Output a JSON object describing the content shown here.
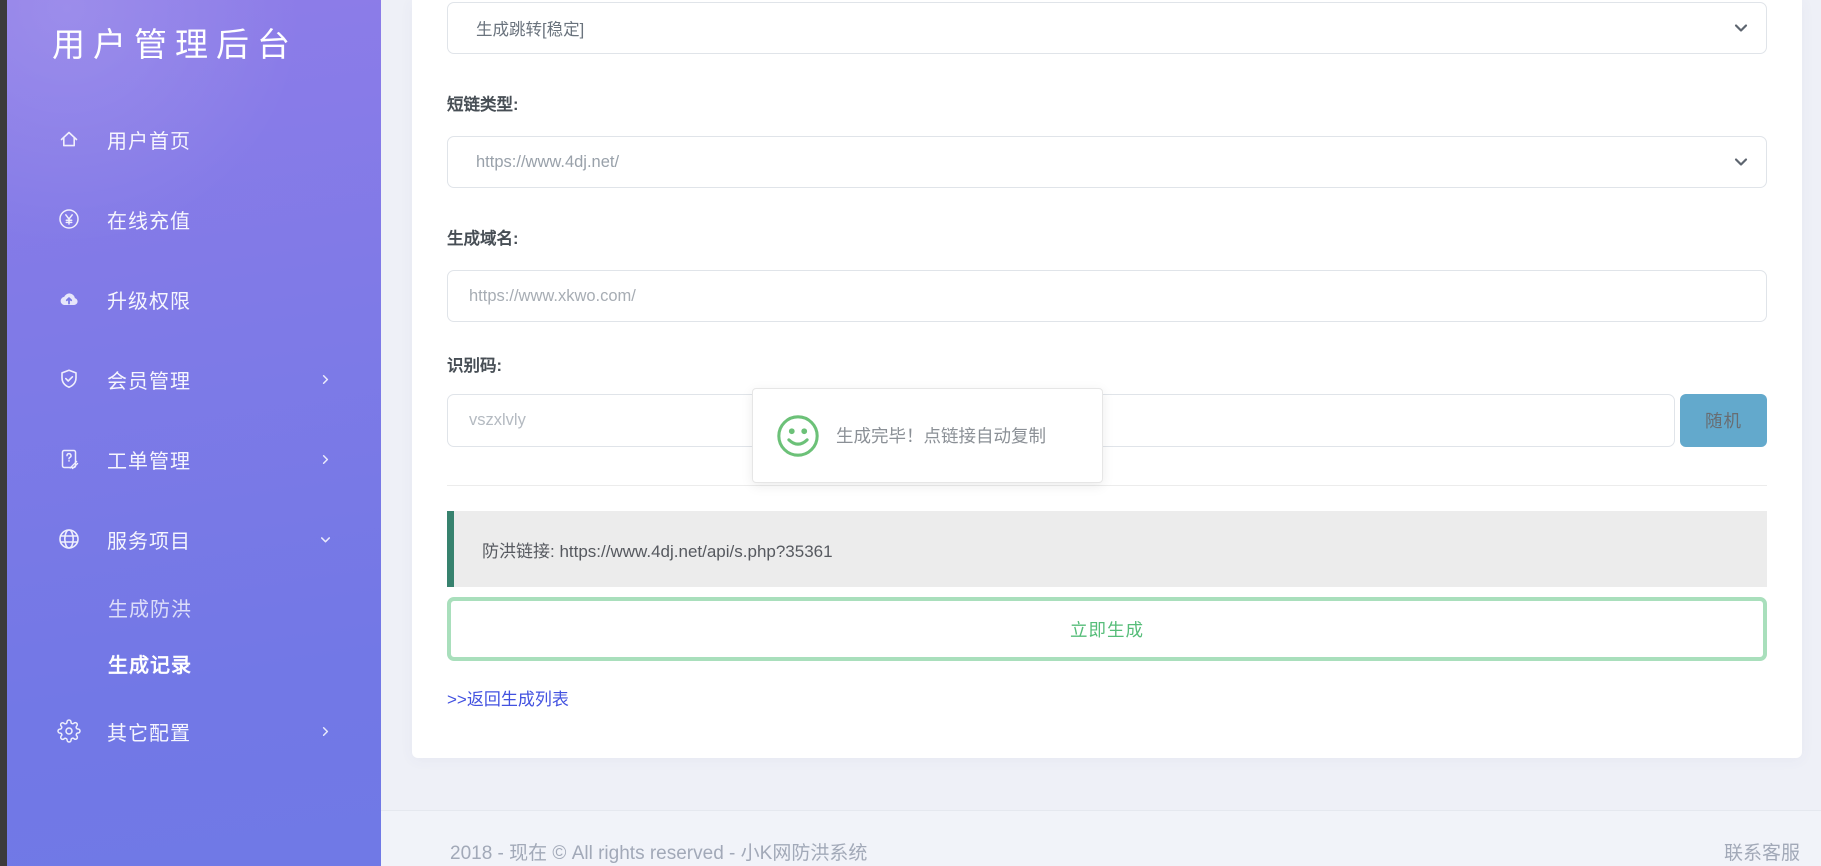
{
  "app": {
    "title": "用户管理后台"
  },
  "sidebar": {
    "items": [
      {
        "icon": "home-icon",
        "label": "用户首页"
      },
      {
        "icon": "yen-circle-icon",
        "label": "在线充值"
      },
      {
        "icon": "cloud-upload-icon",
        "label": "升级权限"
      },
      {
        "icon": "shield-check-icon",
        "label": "会员管理",
        "chevron": "right"
      },
      {
        "icon": "work-order-icon",
        "label": "工单管理",
        "chevron": "right"
      },
      {
        "icon": "globe-icon",
        "label": "服务项目",
        "chevron": "down",
        "submenu": [
          {
            "label": "生成防洪",
            "active": false
          },
          {
            "label": "生成记录",
            "active": true
          }
        ]
      },
      {
        "icon": "gear-icon",
        "label": "其它配置",
        "chevron": "right"
      }
    ]
  },
  "form": {
    "mode_select": {
      "value": "生成跳转[稳定]"
    },
    "shortlink_label": "短链类型:",
    "shortlink_select": {
      "value": "https://www.4dj.net/"
    },
    "domain_label": "生成域名:",
    "domain_input": {
      "value": "https://www.xkwo.com/"
    },
    "code_label": "识别码:",
    "code_input": {
      "value": "vszxlvly"
    },
    "random_button": "随机",
    "result_alert": "防洪链接: https://www.4dj.net/api/s.php?35361",
    "generate_button": "立即生成",
    "back_link": ">>返回生成列表"
  },
  "toast": {
    "icon": "smiley-icon",
    "message": "生成完毕！点链接自动复制"
  },
  "footer": {
    "copyright": "2018 - 现在 © All rights reserved - 小K网防洪系统",
    "contact": "联系客服"
  },
  "colors": {
    "sidebar_top": "#8e7ce8",
    "sidebar_bottom": "#7079e6",
    "edge_strip": "#3b3b3b",
    "page_bg": "#eef0f7",
    "alert_border": "#37826e",
    "alert_bg": "#ececec",
    "random_button_bg": "#63a9cc",
    "generate_border": "#a9dfbc",
    "generate_text": "#56bd79",
    "link_blue": "#4352e0",
    "toast_green": "#6cc178"
  }
}
